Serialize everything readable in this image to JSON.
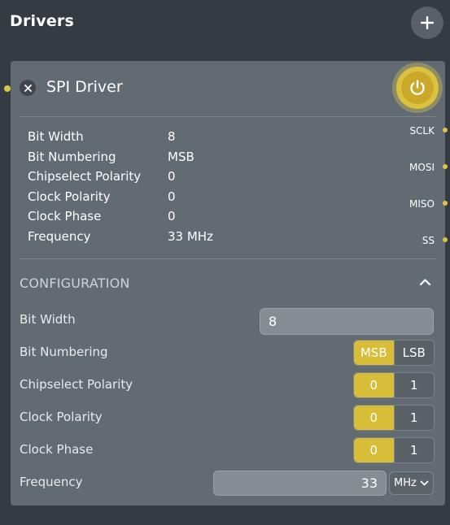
{
  "header": {
    "title": "Drivers",
    "add_icon": "plus-icon"
  },
  "card": {
    "title": "SPI Driver",
    "close_icon": "close-icon",
    "power_icon": "power-icon",
    "summary": [
      {
        "label": "Bit Width",
        "value": "8"
      },
      {
        "label": "Bit Numbering",
        "value": "MSB"
      },
      {
        "label": "Chipselect Polarity",
        "value": "0"
      },
      {
        "label": "Clock Polarity",
        "value": "0"
      },
      {
        "label": "Clock Phase",
        "value": "0"
      },
      {
        "label": "Frequency",
        "value": "33 MHz"
      }
    ],
    "ports": [
      "SCLK",
      "MOSI",
      "MISO",
      "SS"
    ]
  },
  "config": {
    "heading": "CONFIGURATION",
    "bit_width": {
      "label": "Bit Width",
      "value": "8"
    },
    "bit_numbering": {
      "label": "Bit Numbering",
      "options": [
        "MSB",
        "LSB"
      ],
      "selected": "MSB"
    },
    "chipselect_polarity": {
      "label": "Chipselect Polarity",
      "options": [
        "0",
        "1"
      ],
      "selected": "0"
    },
    "clock_polarity": {
      "label": "Clock Polarity",
      "options": [
        "0",
        "1"
      ],
      "selected": "0"
    },
    "clock_phase": {
      "label": "Clock Phase",
      "options": [
        "0",
        "1"
      ],
      "selected": "0"
    },
    "frequency": {
      "label": "Frequency",
      "value": "33",
      "unit": "MHz"
    }
  },
  "colors": {
    "accent": "#d8bd38",
    "background": "#353b42",
    "card": "#636b72"
  }
}
